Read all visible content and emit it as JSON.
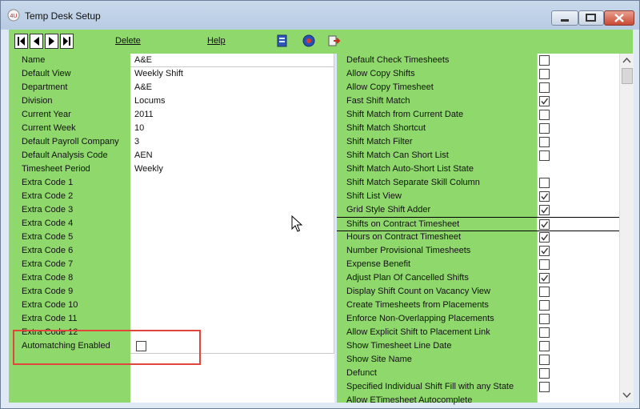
{
  "window": {
    "title": "Temp Desk Setup"
  },
  "toolbar": {
    "delete_label": "Delete",
    "help_label": "Help"
  },
  "fields": [
    {
      "label": "Name",
      "value": "A&E"
    },
    {
      "label": "Default View",
      "value": "Weekly Shift"
    },
    {
      "label": "Department",
      "value": "A&E"
    },
    {
      "label": "Division",
      "value": "Locums"
    },
    {
      "label": "Current Year",
      "value": "2011"
    },
    {
      "label": "Current Week",
      "value": "10"
    },
    {
      "label": "Default Payroll Company",
      "value": "3"
    },
    {
      "label": "Default Analysis Code",
      "value": "AEN"
    },
    {
      "label": "Timesheet Period",
      "value": "Weekly"
    },
    {
      "label": "Extra Code 1",
      "value": ""
    },
    {
      "label": "Extra Code 2",
      "value": ""
    },
    {
      "label": "Extra Code 3",
      "value": ""
    },
    {
      "label": "Extra Code 4",
      "value": ""
    },
    {
      "label": "Extra Code 5",
      "value": ""
    },
    {
      "label": "Extra Code 6",
      "value": ""
    },
    {
      "label": "Extra Code 7",
      "value": ""
    },
    {
      "label": "Extra Code 8",
      "value": ""
    },
    {
      "label": "Extra Code 9",
      "value": ""
    },
    {
      "label": "Extra Code 10",
      "value": ""
    },
    {
      "label": "Extra Code 11",
      "value": ""
    },
    {
      "label": "Extra Code 12",
      "value": ""
    }
  ],
  "automatching": {
    "label": "Automatching Enabled",
    "checked": false
  },
  "options": [
    {
      "label": "Default Check Timesheets",
      "checkbox": true,
      "checked": false
    },
    {
      "label": "Allow Copy Shifts",
      "checkbox": true,
      "checked": false
    },
    {
      "label": "Allow Copy Timesheet",
      "checkbox": true,
      "checked": false
    },
    {
      "label": "Fast Shift Match",
      "checkbox": true,
      "checked": true
    },
    {
      "label": "Shift Match from Current Date",
      "checkbox": true,
      "checked": false
    },
    {
      "label": "Shift Match Shortcut",
      "checkbox": true,
      "checked": false
    },
    {
      "label": "Shift Match Filter",
      "checkbox": true,
      "checked": false
    },
    {
      "label": "Shift Match Can Short List",
      "checkbox": true,
      "checked": false
    },
    {
      "label": "Shift Match Auto-Short List State",
      "checkbox": false,
      "checked": false
    },
    {
      "label": "Shift Match Separate Skill Column",
      "checkbox": true,
      "checked": false
    },
    {
      "label": "Shift List View",
      "checkbox": true,
      "checked": true
    },
    {
      "label": "Grid Style Shift Adder",
      "checkbox": true,
      "checked": true
    },
    {
      "label": "Shifts on Contract Timesheet",
      "checkbox": true,
      "checked": true,
      "selected": true
    },
    {
      "label": "Hours on Contract Timesheet",
      "checkbox": true,
      "checked": true
    },
    {
      "label": "Number Provisional Timesheets",
      "checkbox": true,
      "checked": true
    },
    {
      "label": "Expense Benefit",
      "checkbox": true,
      "checked": false
    },
    {
      "label": "Adjust Plan Of Cancelled Shifts",
      "checkbox": true,
      "checked": true
    },
    {
      "label": "Display Shift Count on Vacancy View",
      "checkbox": true,
      "checked": false
    },
    {
      "label": "Create Timesheets from Placements",
      "checkbox": true,
      "checked": false
    },
    {
      "label": "Enforce Non-Overlapping Placements",
      "checkbox": true,
      "checked": false
    },
    {
      "label": "Allow Explicit Shift to Placement Link",
      "checkbox": true,
      "checked": false
    },
    {
      "label": "Show Timesheet Line Date",
      "checkbox": true,
      "checked": false
    },
    {
      "label": "Show Site Name",
      "checkbox": true,
      "checked": false
    },
    {
      "label": "Defunct",
      "checkbox": true,
      "checked": false
    },
    {
      "label": "Specified Individual Shift Fill with any State",
      "checkbox": true,
      "checked": false
    },
    {
      "label": "Allow ETimesheet Autocomplete",
      "checkbox": false,
      "checked": false
    }
  ],
  "colors": {
    "panel_green": "#8fd96c",
    "highlight_red": "#e0463c",
    "titlebar": "#c9d9ec"
  },
  "icons": [
    "app-icon",
    "first-record-icon",
    "prev-record-icon",
    "next-record-icon",
    "last-record-icon",
    "document-icon",
    "refresh-icon",
    "exit-icon",
    "minimize-icon",
    "maximize-icon",
    "close-icon",
    "mouse-cursor-icon"
  ]
}
